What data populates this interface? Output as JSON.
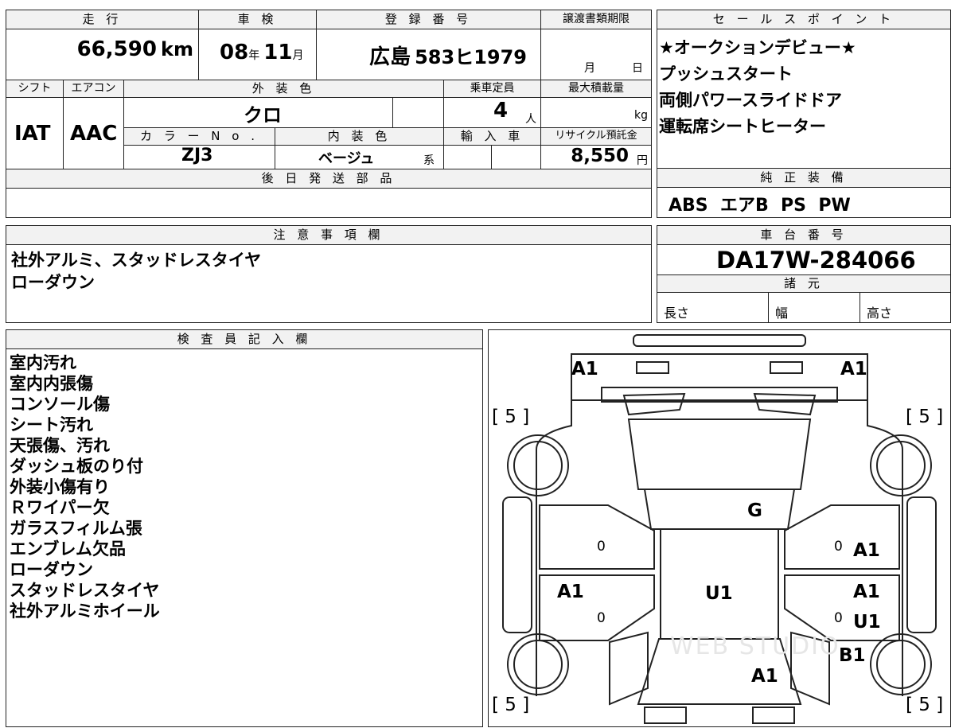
{
  "sheet": {
    "top_headers": {
      "mileage": "走 行",
      "inspection": "車 検",
      "registration": "登 録 番 号",
      "transfer_deadline": "譲渡書類期限",
      "sales_point": "セ ー ル ス ポ イ ン ト",
      "shift": "シフト",
      "aircon": "エアコン",
      "exterior_color": "外 装 色",
      "capacity": "乗車定員",
      "max_load": "最大積載量",
      "color_no": "カ ラ ー N o .",
      "interior_color": "内 装 色",
      "import": "輸 入 車",
      "recycle_fee": "リサイクル預託金",
      "later_parts": "後 日 発 送 部 品",
      "genuine_equipment": "純 正 装 備",
      "notes": "注 意 事 項 欄",
      "chassis_number": "車 台 番 号",
      "specs": "諸 元",
      "inspector": "検 査 員 記 入 欄"
    },
    "values": {
      "mileage_value": "66,590",
      "mileage_unit": "km",
      "inspection_year": "08",
      "year_unit": "年",
      "inspection_month": "11",
      "month_unit": "月",
      "plate_region": "広島",
      "plate_number": "583ヒ1979",
      "deadline_month_unit": "月",
      "deadline_day_unit": "日",
      "shift_value": "IAT",
      "aircon_value": "AAC",
      "exterior_color_value": "クロ",
      "capacity_value": "4",
      "capacity_unit": "人",
      "max_load_unit": "kg",
      "color_no_value": "ZJ3",
      "interior_color_value": "ベージュ",
      "interior_color_suffix": "系",
      "recycle_fee_value": "8,550",
      "recycle_fee_unit": "円",
      "genuine_equipment_value": "ABS  エアB  PS  PW",
      "chassis_number_value": "DA17W-284066",
      "spec_length": "長さ",
      "spec_width": "幅",
      "spec_height": "高さ"
    },
    "sales_points": [
      "★オークションデビュー★",
      "プッシュスタート",
      "両側パワースライドドア",
      "運転席シートヒーター"
    ],
    "notes_lines": [
      "社外アルミ、スタッドレスタイヤ",
      "ローダウン"
    ],
    "inspector_lines": [
      "室内汚れ",
      "室内内張傷",
      "コンソール傷",
      "シート汚れ",
      "天張傷、汚れ",
      "ダッシュ板のり付",
      "外装小傷有り",
      "Ｒワイパー欠",
      "ガラスフィルム張",
      "エンブレム欠品",
      "ローダウン",
      "スタッドレスタイヤ",
      "社外アルミホイール"
    ],
    "diagram": {
      "front_left": "A1",
      "front_right": "A1",
      "tire_fl": "[ 5 ]",
      "tire_fr": "[ 5 ]",
      "tire_rl": "[ 5 ]",
      "tire_rr": "[ 5 ]",
      "windshield": "G",
      "roof": "U1",
      "left_rear_door": "A1",
      "right_front_door": "A1",
      "right_rear_door_a": "A1",
      "right_rear_door_u": "U1",
      "right_rear_quarter": "B1",
      "rear": "A1",
      "zero_a": "0",
      "zero_b": "0",
      "zero_c": "0",
      "zero_d": "0",
      "watermark": "WEB STUDIO"
    }
  }
}
